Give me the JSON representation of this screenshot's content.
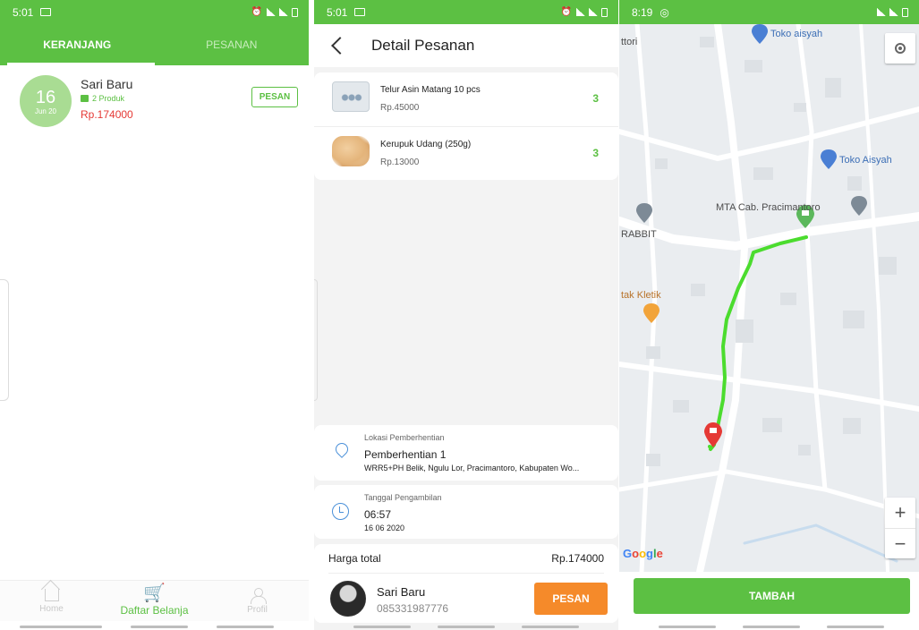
{
  "screen1": {
    "status": {
      "time": "5:01"
    },
    "tabs": [
      {
        "label": "KERANJANG"
      },
      {
        "label": "PESANAN"
      }
    ],
    "cart": {
      "day": "16",
      "month": "Jun 20",
      "store": "Sari Baru",
      "products": "2 Produk",
      "price": "Rp.174000",
      "order_label": "PESAN"
    },
    "nav": [
      {
        "label": "Home"
      },
      {
        "label": "Daftar Belanja"
      },
      {
        "label": "Profil"
      }
    ]
  },
  "screen2": {
    "status": {
      "time": "5:01"
    },
    "title": "Detail Pesanan",
    "items": [
      {
        "name": "Telur Asin Matang 10 pcs",
        "price": "Rp.45000",
        "qty": "3"
      },
      {
        "name": "Kerupuk Udang (250g)",
        "price": "Rp.13000",
        "qty": "3"
      }
    ],
    "location": {
      "label": "Lokasi Pemberhentian",
      "name": "Pemberhentian 1",
      "address": "WRR5+PH Belik, Ngulu Lor, Pracimantoro, Kabupaten Wo..."
    },
    "pickup": {
      "label": "Tanggal Pengambilan",
      "time": "06:57",
      "date": "16 06 2020"
    },
    "total": {
      "label": "Harga total",
      "value": "Rp.174000"
    },
    "buyer": {
      "name": "Sari Baru",
      "phone": "085331987776"
    },
    "order_label": "PESAN"
  },
  "screen3": {
    "status": {
      "time": "8:19"
    },
    "map_labels": {
      "ttori": "ttori",
      "toko1": "Toko aisyah",
      "toko2": "Toko Aisyah",
      "mta": "MTA Cab. Pracimantoro",
      "rabbit": "RABBIT",
      "kletik": "tak Kletik",
      "google": "Google"
    },
    "route_color": "#4bdc2e",
    "zoom_in": "+",
    "zoom_out": "−",
    "add_label": "TAMBAH"
  },
  "colors": {
    "primary": "#5cc043",
    "accent": "#f58a2a",
    "price": "#e53935",
    "icon_blue": "#4a90d9"
  }
}
